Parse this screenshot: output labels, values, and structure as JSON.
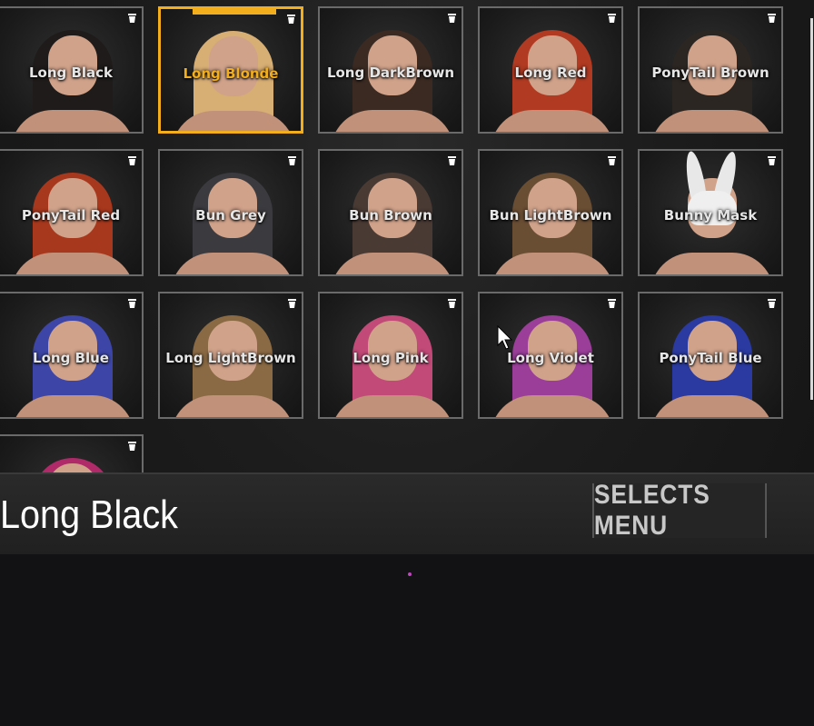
{
  "items": [
    {
      "label": "Long Black",
      "hair": "#1e1b1a",
      "type": "hair"
    },
    {
      "label": "Long Blonde",
      "hair": "#d7ae74",
      "type": "hair",
      "selected": true
    },
    {
      "label": "Long DarkBrown",
      "hair": "#3a2a22",
      "type": "hair"
    },
    {
      "label": "Long Red",
      "hair": "#b03a22",
      "type": "hair"
    },
    {
      "label": "PonyTail Brown",
      "hair": "#2c2622",
      "type": "hair"
    },
    {
      "label": "PonyTail Red",
      "hair": "#a8381d",
      "type": "hair"
    },
    {
      "label": "Bun Grey",
      "hair": "#3b3b3f",
      "type": "hair"
    },
    {
      "label": "Bun Brown",
      "hair": "#4a3a34",
      "type": "hair"
    },
    {
      "label": "Bun LightBrown",
      "hair": "#6a4e34",
      "type": "hair"
    },
    {
      "label": "Bunny Mask",
      "hair": "#e8e8e8",
      "type": "mask"
    },
    {
      "label": "Long Blue",
      "hair": "#3d46a6",
      "type": "hair"
    },
    {
      "label": "Long LightBrown",
      "hair": "#8a6a44",
      "type": "hair"
    },
    {
      "label": "Long Pink",
      "hair": "#c24a78",
      "type": "hair"
    },
    {
      "label": "Long Violet",
      "hair": "#9a3e9a",
      "type": "hair"
    },
    {
      "label": "PonyTail Blue",
      "hair": "#2a3aa0",
      "type": "hair"
    },
    {
      "label": "",
      "hair": "#b02a6a",
      "type": "hair"
    }
  ],
  "selected_name": "Long Black",
  "selects_menu_label": "SELECTS MENU",
  "colors": {
    "accent": "#f2ae1c",
    "tile_border": "#6a6a6a",
    "background": "#1c1c1c"
  },
  "icons": {
    "tile_corner": "trash-icon",
    "pointer": "cursor-icon"
  }
}
